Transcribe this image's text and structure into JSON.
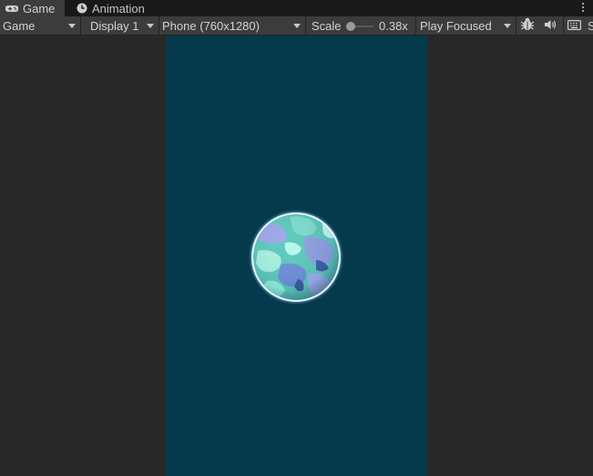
{
  "tabs": [
    {
      "label": "Game",
      "icon": "gamepad-icon",
      "active": true
    },
    {
      "label": "Animation",
      "icon": "clock-icon",
      "active": false
    }
  ],
  "toolbar": {
    "view_mode": "Game",
    "display": "Display 1",
    "resolution": "Phone (760x1280)",
    "scale_label": "Scale",
    "scale_value": "0.38x",
    "scale_level": 0.05,
    "play_mode": "Play Focused",
    "icons": [
      "bug-icon",
      "speaker-icon",
      "keyboard-icon"
    ],
    "truncated_label": "S"
  },
  "colors": {
    "panel_bg": "#282828",
    "toolbar_bg": "#3c3c3c",
    "tab_strip_bg": "#191919",
    "game_bg": "#043a4c",
    "planet_fill": "#5ec9bd",
    "planet_glow": "#bfe7ff"
  }
}
